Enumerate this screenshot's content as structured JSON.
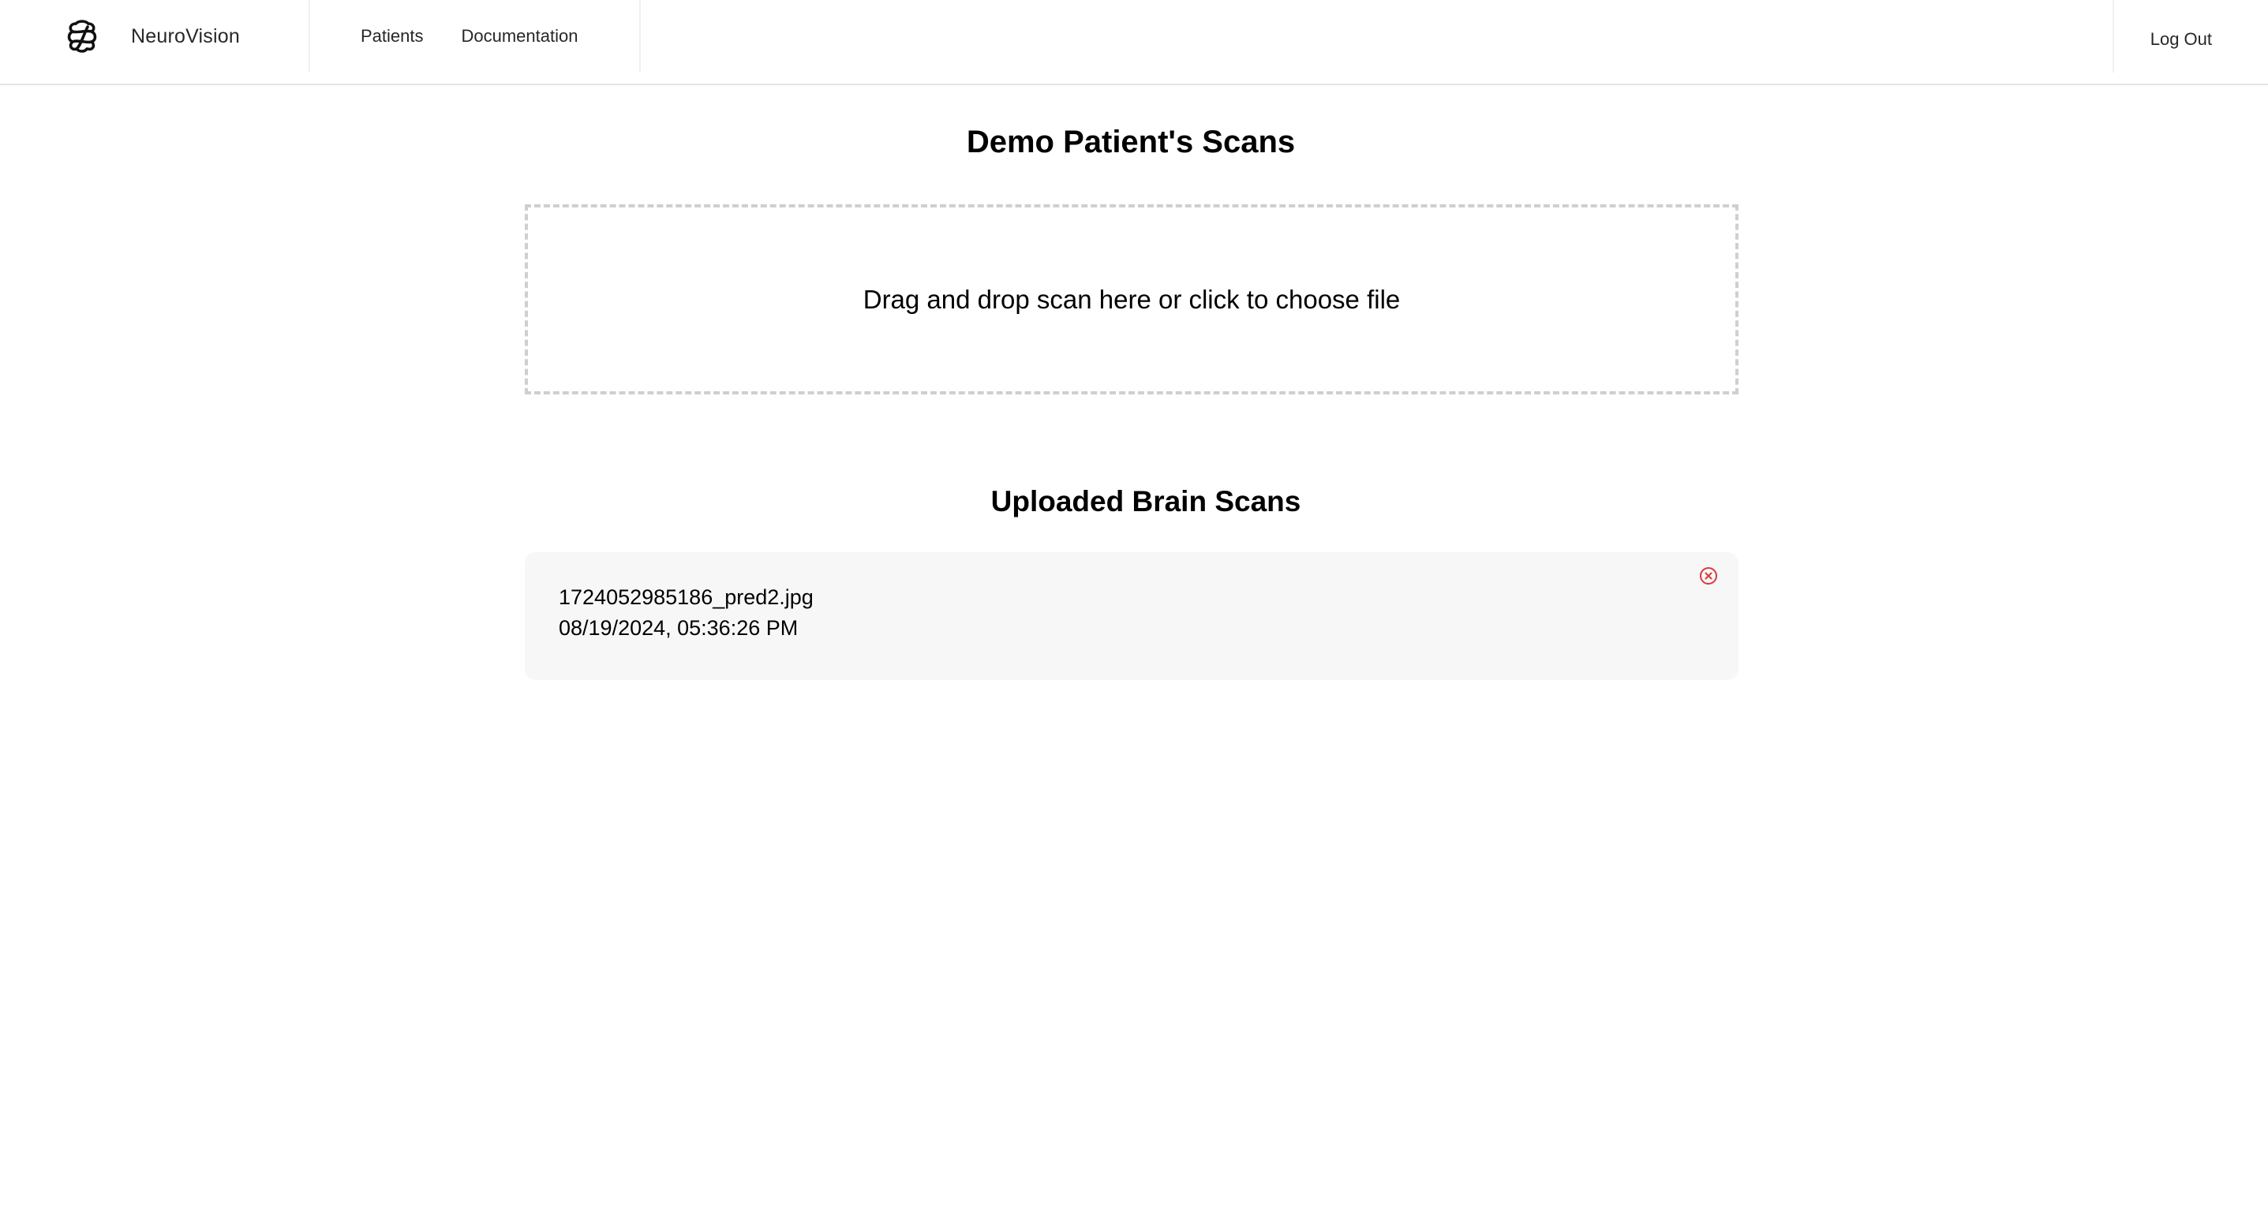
{
  "header": {
    "brand_name": "NeuroVision",
    "logo_icon": "brain-knot-icon",
    "nav": [
      {
        "label": "Patients"
      },
      {
        "label": "Documentation"
      }
    ],
    "logout_label": "Log Out"
  },
  "main": {
    "title": "Demo Patient's Scans",
    "dropzone_text": "Drag and drop scan here or click to choose file",
    "uploaded_title": "Uploaded Brain Scans",
    "scans": [
      {
        "filename": "1724052985186_pred2.jpg",
        "timestamp": "08/19/2024, 05:36:26 PM",
        "remove_icon": "close-circle-icon"
      }
    ]
  },
  "colors": {
    "remove_icon": "#d93b3b",
    "card_background": "#f7f7f7",
    "dropzone_border": "#cfcfcf",
    "nav_text": "#27272a"
  }
}
